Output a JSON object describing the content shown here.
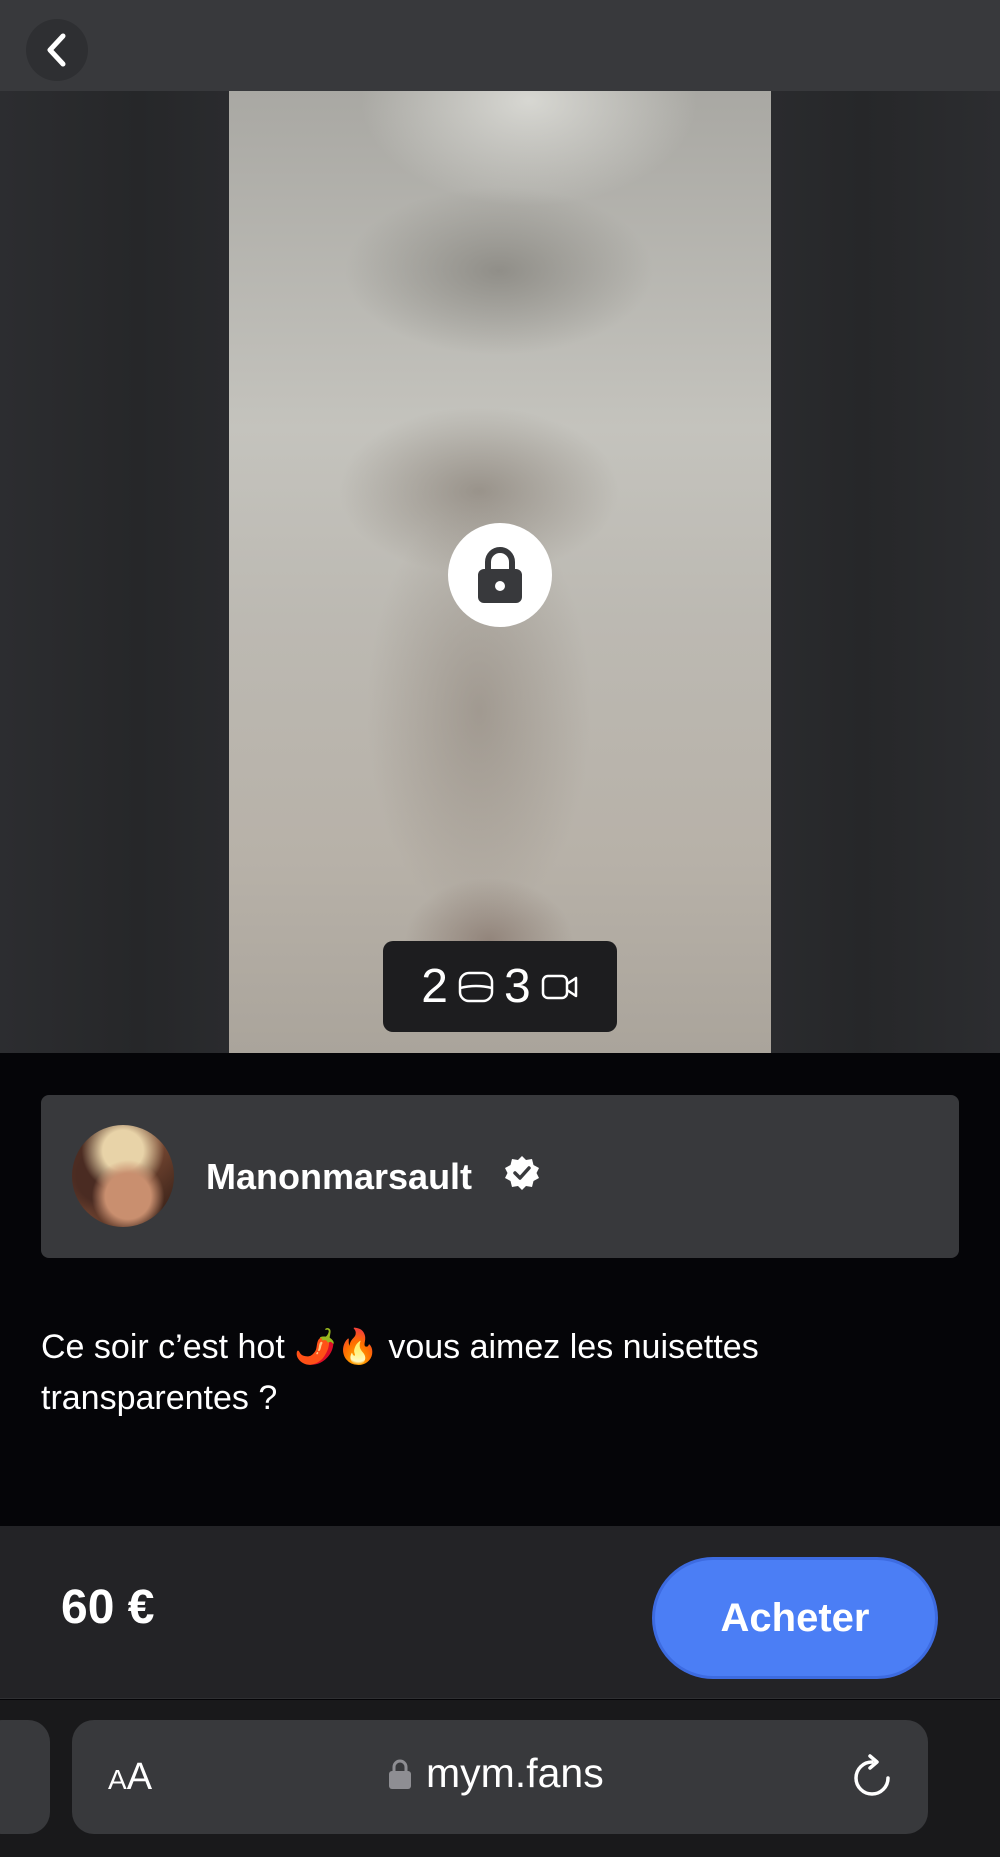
{
  "topbar": {
    "back_icon": "chevron-left-icon"
  },
  "media": {
    "lock_icon": "lock-icon",
    "photo_count": "2",
    "photo_icon": "photo-icon",
    "video_count": "3",
    "video_icon": "video-camera-icon"
  },
  "creator": {
    "name": "Manonmarsault",
    "verified_icon": "verified-badge-icon"
  },
  "post": {
    "caption": "Ce soir c’est hot 🌶️🔥 vous aimez les nuisettes transparentes ?"
  },
  "purchase": {
    "price": "60 €",
    "buy_label": "Acheter",
    "accent_color": "#4b7ef5"
  },
  "browser": {
    "text_size_small": "A",
    "text_size_large": "A",
    "url": "mym.fans",
    "lock_icon": "lock-icon",
    "reload_icon": "reload-icon"
  }
}
